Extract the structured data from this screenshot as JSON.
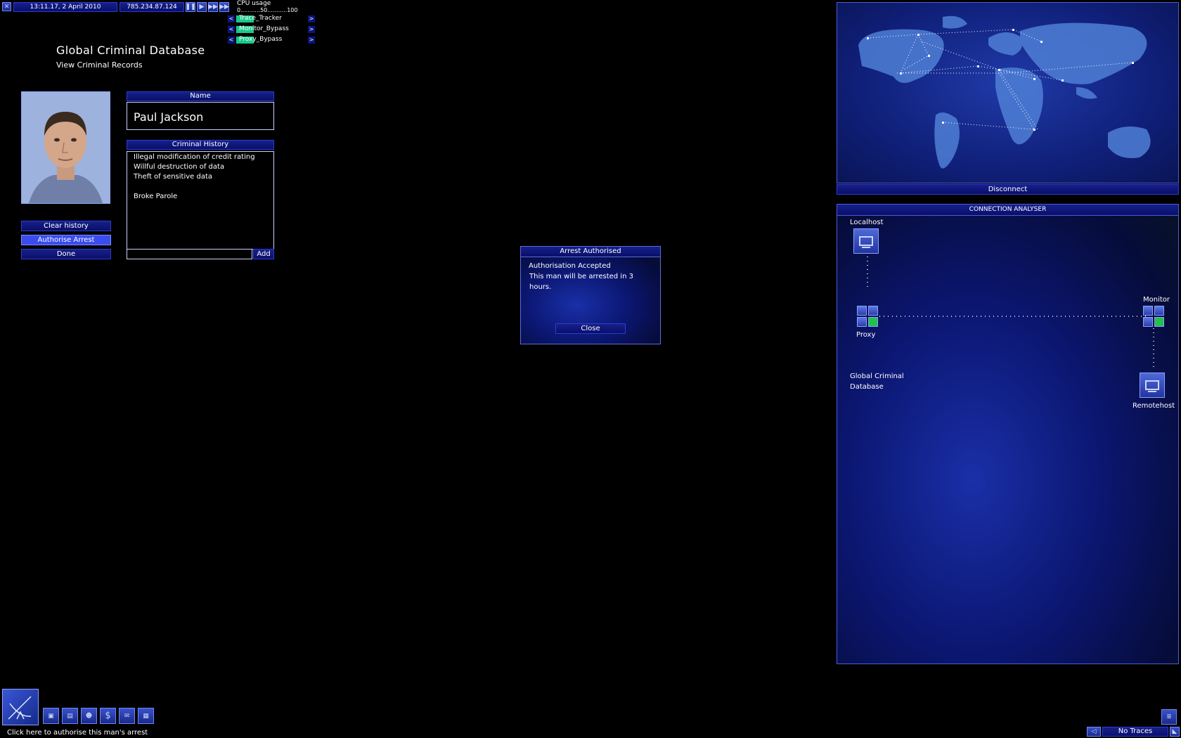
{
  "topbar": {
    "clock": "13:11.17, 2 April 2010",
    "ip": "785.234.87.124",
    "cpu_label": "CPU usage",
    "cpu_scale": "0...........50...........100",
    "programs": [
      {
        "name": "Trace_Tracker",
        "progress": 0.25
      },
      {
        "name": "Monitor_Bypass",
        "progress": 0.25
      },
      {
        "name": "Proxy_Bypass",
        "progress": 0.25
      }
    ]
  },
  "page": {
    "title": "Global Criminal Database",
    "subtitle": "View Criminal Records"
  },
  "record": {
    "name_header": "Name",
    "name": "Paul Jackson",
    "history_header": "Criminal History",
    "history": [
      "Illegal modification of credit rating",
      "Willful destruction of data",
      "Theft of sensitive data",
      "",
      "Broke Parole"
    ],
    "add_label": "Add",
    "add_value": ""
  },
  "actions": {
    "clear": "Clear history",
    "authorise": "Authorise Arrest",
    "done": "Done"
  },
  "dialog": {
    "title": "Arrest Authorised",
    "line1": "Authorisation Accepted",
    "line2": "This man will be arrested in 3",
    "line3": "hours.",
    "close": "Close"
  },
  "map": {
    "disconnect": "Disconnect"
  },
  "analyser": {
    "title": "CONNECTION ANALYSER",
    "localhost": "Localhost",
    "proxy": "Proxy",
    "monitor": "Monitor",
    "remotehost": "Remotehost",
    "target_line1": "Global Criminal",
    "target_line2": "Database"
  },
  "statusbar": {
    "hint": "Click here to authorise this man's arrest",
    "traces": "No Traces"
  },
  "colors": {
    "accent": "#0b1480",
    "highlight": "#3a4cf0",
    "progress": "#19c98a"
  }
}
